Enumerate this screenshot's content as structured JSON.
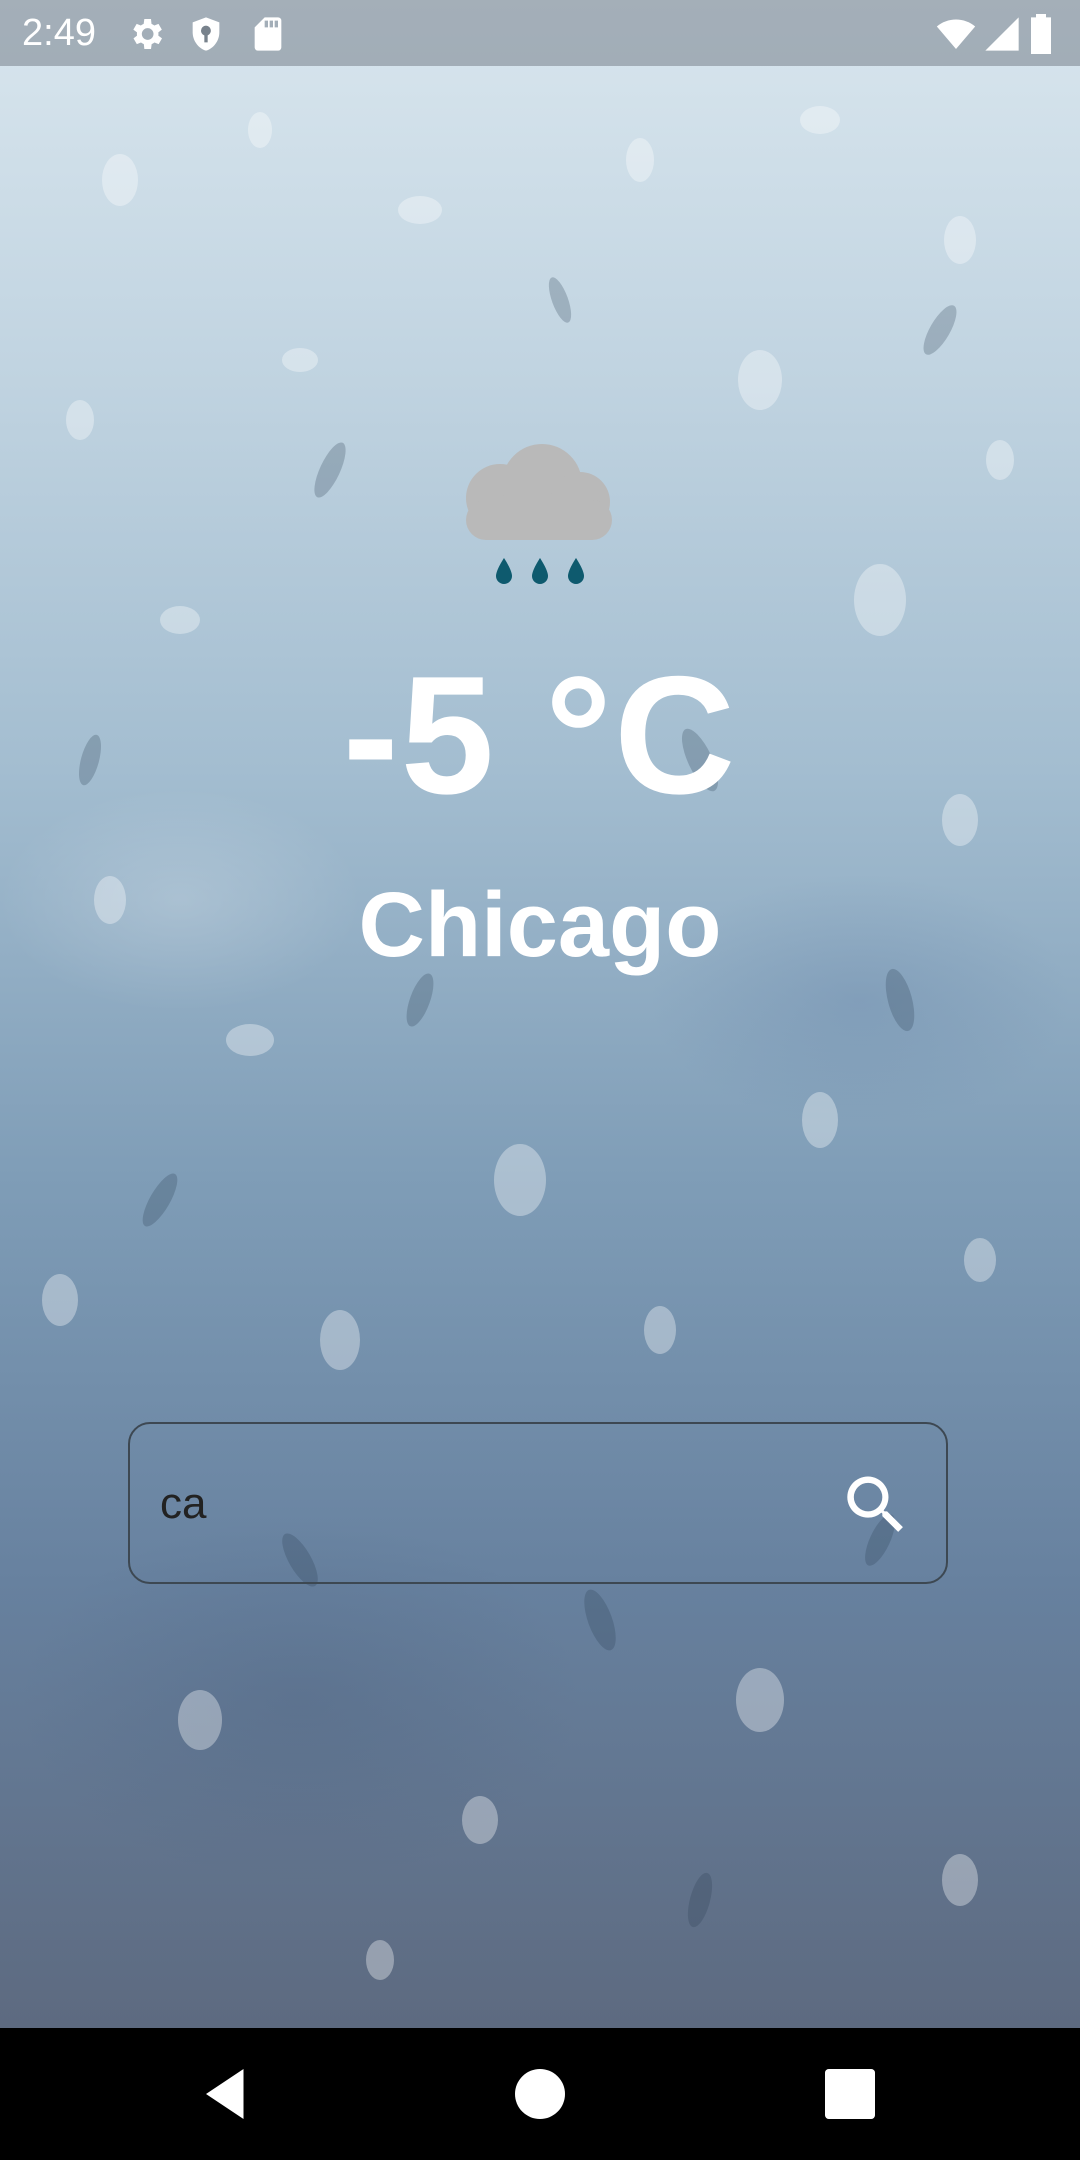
{
  "status_bar": {
    "time": "2:49",
    "left_icons": [
      "gear-icon",
      "shield-icon",
      "sd-card-icon"
    ],
    "right_icons": [
      "wifi-icon",
      "cellular-signal-icon",
      "battery-icon"
    ]
  },
  "weather": {
    "condition_icon": "cloud-rain-icon",
    "temperature": "-5 °C",
    "city": "Chicago"
  },
  "search": {
    "value": "ca",
    "button_icon": "search-icon"
  },
  "nav_bar": {
    "buttons": [
      "back-icon",
      "home-icon",
      "recents-icon"
    ]
  },
  "colors": {
    "text": "#ffffff",
    "rain_drop": "#0e5a6e",
    "cloud": "#b9b9b9",
    "field_border": "#3d4852"
  }
}
